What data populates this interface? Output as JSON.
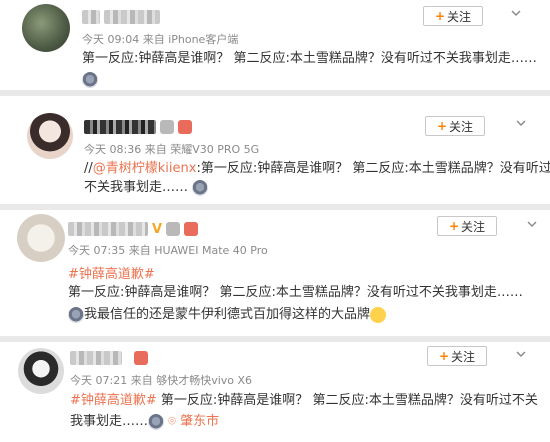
{
  "follow_label": "关注",
  "follow_plus": "+",
  "accent_color": "#eb7350",
  "posts": [
    {
      "meta": "今天 09:04 来自 iPhone客户端",
      "line1": "第一反应:钟薛高是谁啊？ 第二反应:本土雪糕品牌？没有听过不关我事划走……"
    },
    {
      "meta": "今天 08:36 来自 荣耀V30 PRO 5G",
      "prefix": "//",
      "mention": "@青树柠檬kiienx",
      "line1_rest": ":第一反应:钟薛高是谁啊？ 第二反应:本土雪糕品牌？没有听过",
      "line2": "不关我事划走……"
    },
    {
      "meta": "今天 07:35 来自 HUAWEI Mate 40 Pro",
      "hashtag": "#钟薛高道歉#",
      "line1": "第一反应:钟薛高是谁啊？ 第二反应:本土雪糕品牌？没有听过不关我事划走……",
      "line2": "我最信任的还是蒙牛伊利德式百加得这样的大品牌"
    },
    {
      "meta": "今天 07:21 来自 够快才畅快vivo X6",
      "hashtag": "#钟薛高道歉#",
      "line1_rest": " 第一反应:钟薛高是谁啊？ 第二反应:本土雪糕品牌？没有听过不关",
      "line2": "我事划走……",
      "location": "肇东市"
    }
  ]
}
